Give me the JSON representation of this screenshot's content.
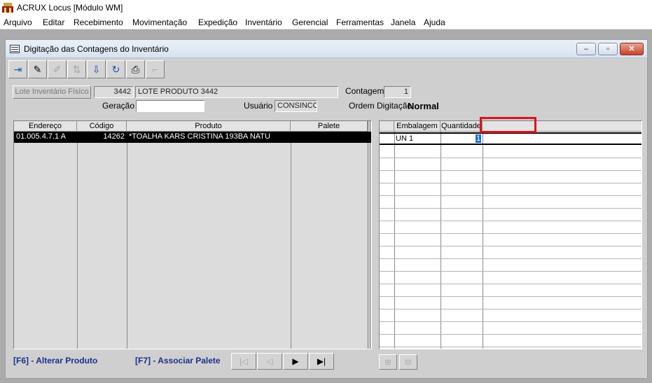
{
  "app": {
    "title": "ACRUX Locus [Módulo WM]"
  },
  "menu": [
    "Arquivo",
    "Editar",
    "Recebimento",
    "Movimentação",
    "Expedição",
    "Inventário",
    "Gerencial",
    "Ferramentas",
    "Janela",
    "Ajuda"
  ],
  "window": {
    "title": "Digitação das Contagens do Inventário",
    "minimize": "–",
    "restore": "▫",
    "close": "✕"
  },
  "toolbar": [
    {
      "icon": "exit-icon",
      "glyph": "⇥",
      "enabled": true
    },
    {
      "icon": "eraser-icon",
      "glyph": "✎",
      "enabled": true
    },
    {
      "icon": "pencil-icon",
      "glyph": "✐",
      "enabled": false
    },
    {
      "icon": "sort-icon",
      "glyph": "⇅",
      "enabled": false
    },
    {
      "icon": "import-icon",
      "glyph": "⇩",
      "enabled": true
    },
    {
      "icon": "refresh-icon",
      "glyph": "↻",
      "enabled": true
    },
    {
      "icon": "print-icon",
      "glyph": "⎙",
      "enabled": true
    },
    {
      "icon": "disabled-action-icon",
      "glyph": "⌐",
      "enabled": false
    }
  ],
  "form": {
    "lote_button": "Lote Inventário Físico",
    "lote_num": "3442",
    "lote_desc": "LOTE PRODUTO 3442",
    "contagem_label": "Contagem",
    "contagem_value": "1",
    "geracao_label": "Geração",
    "geracao_value": "",
    "usuario_label": "Usuário",
    "usuario_value": "CONSINCO",
    "ordem_label": "Ordem Digitação",
    "ordem_value": "Normal"
  },
  "left_grid": {
    "columns": [
      "Endereço",
      "Código",
      "Produto",
      "Palete"
    ],
    "rows": [
      {
        "endereco": "01.005.4.7.1 A",
        "codigo": "14262",
        "produto": "*TOALHA KARS CRISTINA 193BA NATU",
        "palete": ""
      }
    ]
  },
  "right_grid": {
    "columns": [
      "Embalagem",
      "Quantidade",
      ""
    ],
    "rows": [
      {
        "embalagem": "UN 1",
        "quantidade": "1"
      }
    ]
  },
  "bottom": {
    "f6": "[F6] - Alterar Produto",
    "f7": "[F7] - Associar Palete",
    "nav_first": "|◁",
    "nav_prev": "◁",
    "nav_next": "▶",
    "nav_last": "▶|"
  },
  "colors": {
    "highlight_box": "#e1121c",
    "fkey_text": "#1c2f8c"
  }
}
